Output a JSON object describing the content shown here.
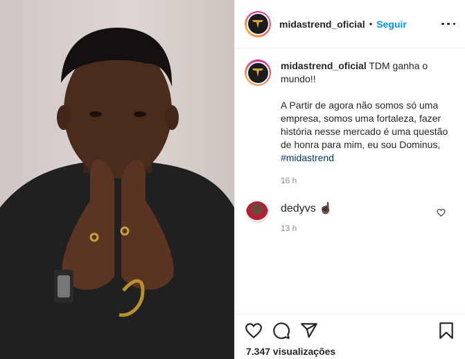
{
  "post": {
    "username": "midastrend_oficial",
    "follow_label": "Seguir",
    "separator": "•"
  },
  "caption": {
    "username": "midastrend_oficial",
    "text_first": "TDM ganha o mundo!!",
    "text_second": "A Partir de agora não somos só uma empresa, somos uma fortaleza, fazer história nesse mercado é uma questão de honra para mim, eu sou Dominus,",
    "hashtag": "#midastrend",
    "time": "16 h"
  },
  "comment": {
    "username": "dedyvs",
    "emoji": "☝🏿",
    "time": "13 h"
  },
  "stats": {
    "views": "7.347 visualizações"
  },
  "colors": {
    "accent": "#0095f6",
    "hashtag": "#00376b",
    "muted": "#8e8e8e"
  },
  "icons": [
    "more-icon",
    "heart-icon",
    "comment-icon",
    "share-icon",
    "bookmark-icon"
  ]
}
